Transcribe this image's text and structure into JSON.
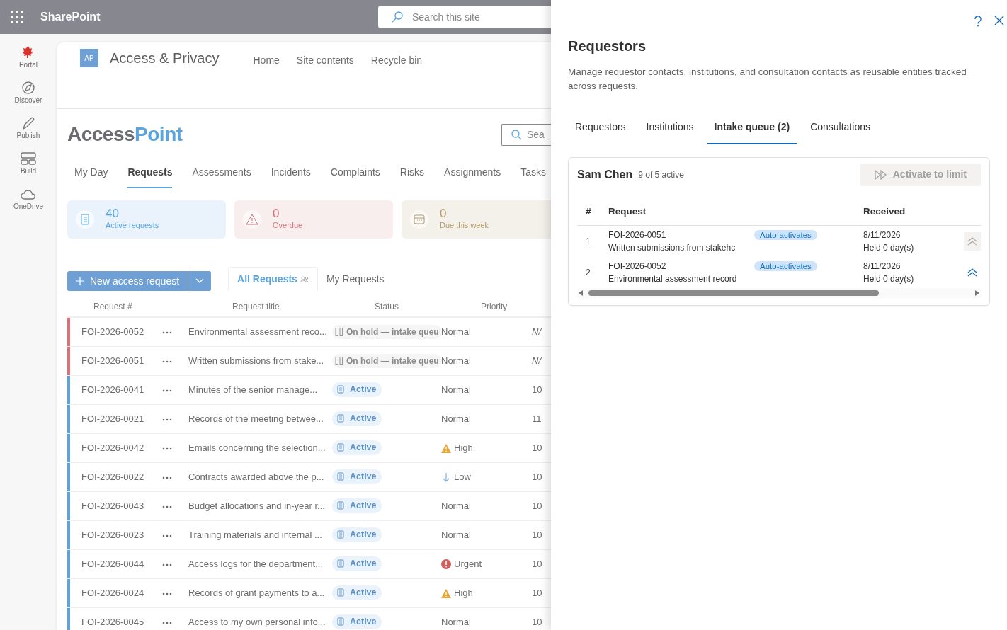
{
  "suite_bar": {
    "app_name": "SharePoint",
    "search_placeholder": "Search this site"
  },
  "left_rail": {
    "items": [
      {
        "label": "Portal"
      },
      {
        "label": "Discover"
      },
      {
        "label": "Publish"
      },
      {
        "label": "Build"
      },
      {
        "label": "OneDrive"
      }
    ]
  },
  "site_header": {
    "logo_initials": "AP",
    "title": "Access & Privacy",
    "nav": [
      "Home",
      "Site contents",
      "Recycle bin"
    ]
  },
  "app": {
    "brand": [
      "Access",
      "Point"
    ],
    "search_placeholder": "Sea",
    "tabs": [
      {
        "label": "My Day",
        "selected": false
      },
      {
        "label": "Requests",
        "selected": true
      },
      {
        "label": "Assessments",
        "selected": false
      },
      {
        "label": "Incidents",
        "selected": false
      },
      {
        "label": "Complaints",
        "selected": false
      },
      {
        "label": "Risks",
        "selected": false
      },
      {
        "label": "Assignments",
        "selected": false
      },
      {
        "label": "Tasks",
        "selected": false
      }
    ],
    "stats": [
      {
        "kind": "info",
        "value": "40",
        "label": "Active requests"
      },
      {
        "kind": "danger",
        "value": "0",
        "label": "Overdue"
      },
      {
        "kind": "warning",
        "value": "0",
        "label": "Due this week"
      }
    ],
    "new_button": "New access request",
    "views": [
      {
        "label": "All Requests",
        "selected": true
      },
      {
        "label": "My Requests",
        "selected": false
      }
    ],
    "table": {
      "columns": [
        "Request #",
        "Request title",
        "Status",
        "Priority"
      ],
      "rows": [
        {
          "color": "#e06c75",
          "id": "FOI-2026-0052",
          "title": "Environmental assessment reco...",
          "status": {
            "kind": "on_hold",
            "label": "On hold — intake queu"
          },
          "priority": {
            "kind": "normal",
            "label": "Normal"
          },
          "column_5": "N/"
        },
        {
          "color": "#e06c75",
          "id": "FOI-2026-0051",
          "title": "Written submissions from stake...",
          "status": {
            "kind": "on_hold",
            "label": "On hold — intake queu"
          },
          "priority": {
            "kind": "normal",
            "label": "Normal"
          },
          "column_5": "N/"
        },
        {
          "color": "#5ba4de",
          "id": "FOI-2026-0041",
          "title": "Minutes of the senior manage...",
          "status": {
            "kind": "active",
            "label": "Active"
          },
          "priority": {
            "kind": "normal",
            "label": "Normal"
          },
          "column_5": "10"
        },
        {
          "color": "#5ba4de",
          "id": "FOI-2026-0021",
          "title": "Records of the meeting betwee...",
          "status": {
            "kind": "active",
            "label": "Active"
          },
          "priority": {
            "kind": "normal",
            "label": "Normal"
          },
          "column_5": "11"
        },
        {
          "color": "#5ba4de",
          "id": "FOI-2026-0042",
          "title": "Emails concerning the selection...",
          "status": {
            "kind": "active",
            "label": "Active"
          },
          "priority": {
            "kind": "high",
            "label": "High"
          },
          "column_5": "10"
        },
        {
          "color": "#5ba4de",
          "id": "FOI-2026-0022",
          "title": "Contracts awarded above the p...",
          "status": {
            "kind": "active",
            "label": "Active"
          },
          "priority": {
            "kind": "low",
            "label": "Low"
          },
          "column_5": "10"
        },
        {
          "color": "#5ba4de",
          "id": "FOI-2026-0043",
          "title": "Budget allocations and in-year r...",
          "status": {
            "kind": "active",
            "label": "Active"
          },
          "priority": {
            "kind": "normal",
            "label": "Normal"
          },
          "column_5": "10"
        },
        {
          "color": "#5ba4de",
          "id": "FOI-2026-0023",
          "title": "Training materials and internal ...",
          "status": {
            "kind": "active",
            "label": "Active"
          },
          "priority": {
            "kind": "normal",
            "label": "Normal"
          },
          "column_5": "10"
        },
        {
          "color": "#5ba4de",
          "id": "FOI-2026-0044",
          "title": "Access logs for the department...",
          "status": {
            "kind": "active",
            "label": "Active"
          },
          "priority": {
            "kind": "urgent",
            "label": "Urgent"
          },
          "column_5": "10"
        },
        {
          "color": "#5ba4de",
          "id": "FOI-2026-0024",
          "title": "Records of grant payments to a...",
          "status": {
            "kind": "active",
            "label": "Active"
          },
          "priority": {
            "kind": "high",
            "label": "High"
          },
          "column_5": "10"
        },
        {
          "color": "#5ba4de",
          "id": "FOI-2026-0045",
          "title": "Access to my own personal info...",
          "status": {
            "kind": "active",
            "label": "Active"
          },
          "priority": {
            "kind": "normal",
            "label": "Normal"
          },
          "column_5": "10"
        }
      ]
    }
  },
  "panel": {
    "title": "Requestors",
    "description": "Manage requestor contacts, institutions, and consultation contacts as reusable entities tracked across requests.",
    "tabs": [
      {
        "label": "Requestors",
        "selected": false
      },
      {
        "label": "Institutions",
        "selected": false
      },
      {
        "label": "Intake queue (2)",
        "selected": true
      },
      {
        "label": "Consultations",
        "selected": false
      }
    ],
    "queue": {
      "name": "Sam Chen",
      "count": "9 of 5 active",
      "activate_button": {
        "label": "Activate to limit",
        "disabled": true
      },
      "columns": [
        "#",
        "Request",
        "Received"
      ],
      "rows": [
        {
          "number": "1",
          "id": "FOI-2026-0051",
          "title": "Written submissions from stakehc",
          "badge": "Auto-activates",
          "received": "8/11/2026",
          "held": "Held 0 day(s)",
          "move_up_disabled": true
        },
        {
          "number": "2",
          "id": "FOI-2026-0052",
          "title": "Environmental assessment record",
          "badge": "Auto-activates",
          "received": "8/11/2026",
          "held": "Held 0 day(s)",
          "move_up_disabled": false
        }
      ]
    }
  }
}
